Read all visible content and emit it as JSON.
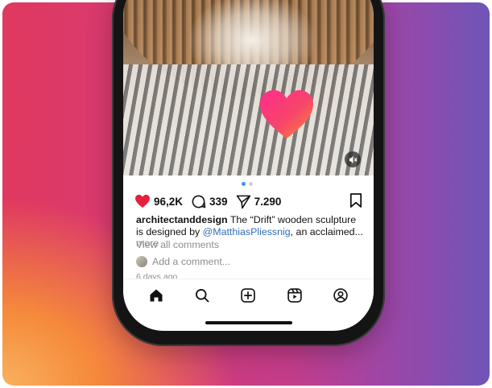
{
  "post": {
    "likes": "96,2K",
    "comments": "339",
    "shares": "7.290",
    "username": "architectanddesign",
    "caption_text": " The “Drift” wooden sculpture is designed by ",
    "mention": "@MatthiasPliessnig",
    "caption_tail": ", an acclaimed...",
    "more_label": "more",
    "view_all_comments": "View all comments",
    "add_comment_placeholder": "Add a comment...",
    "time_ago": "6 days ago"
  },
  "carousel": {
    "current": 1,
    "total": 2
  },
  "icons": {
    "like": "heart-filled-icon",
    "comment": "comment-bubble-icon",
    "share": "paper-plane-icon",
    "save": "bookmark-icon",
    "mute": "speaker-muted-icon",
    "overlay": "heart-like-animation-icon"
  },
  "nav": [
    "home-icon",
    "search-icon",
    "create-icon",
    "reels-icon",
    "profile-icon"
  ],
  "colors": {
    "like_red": "#e8203a",
    "mention_blue": "#2f6fb6",
    "active_dot": "#3897f0"
  }
}
